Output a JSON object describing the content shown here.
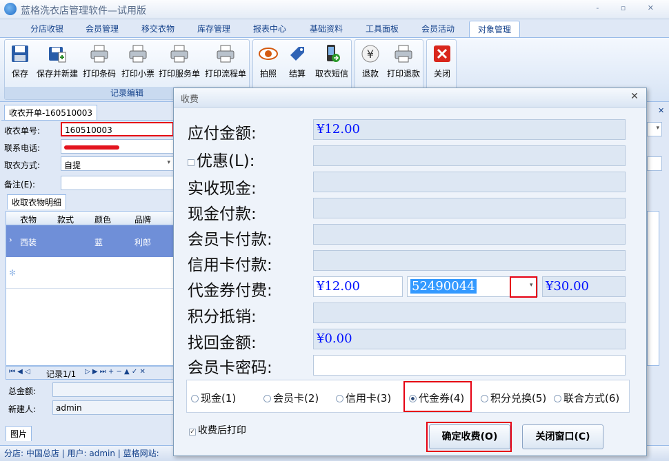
{
  "window": {
    "title": "蓝格洗衣店管理软件—试用版",
    "controls": "- ▫ ✕"
  },
  "tabs": [
    "分店收银",
    "会员管理",
    "移交衣物",
    "库存管理",
    "报表中心",
    "基础资料",
    "工具面板",
    "会员活动",
    "对象管理"
  ],
  "ribbon": {
    "group1": {
      "title": "记录编辑",
      "buttons": [
        "保存",
        "保存并新建",
        "打印条码",
        "打印小票",
        "打印服务单",
        "打印流程单"
      ]
    },
    "group2": {
      "buttons": [
        "拍照",
        "结算",
        "取衣短信"
      ]
    },
    "group3": {
      "buttons": [
        "退款",
        "打印退款"
      ]
    },
    "group4": {
      "buttons": [
        "关闭"
      ]
    }
  },
  "order": {
    "doc_tab": "收衣开单-160510003",
    "order_no_label": "收衣单号:",
    "order_no": "160510003",
    "phone_label": "联系电话:",
    "pickup_label": "取衣方式:",
    "pickup": "自提",
    "remark_label": "备注(E):",
    "detail_tab": "收取衣物明细",
    "columns": [
      "衣物",
      "款式",
      "颜色",
      "品牌"
    ],
    "row": {
      "item": "西装",
      "style": "",
      "color": "蓝",
      "brand": "利郎"
    },
    "pager": "记录1/1",
    "total_label": "总金额:",
    "creator_label": "新建人:",
    "creator": "admin",
    "image_tab": "图片"
  },
  "status": {
    "text": "分店: 中国总店 | 用户: admin | 蓝格网站:"
  },
  "dialog": {
    "title": "收费",
    "labels": {
      "payable": "应付金额:",
      "discount": "优惠(L):",
      "actual_cash": "实收现金:",
      "cash_pay": "现金付款:",
      "member_pay": "会员卡付款:",
      "credit_pay": "信用卡付款:",
      "voucher_pay": "代金券付费:",
      "points": "积分抵销:",
      "change": "找回金额:",
      "member_pwd": "会员卡密码:"
    },
    "values": {
      "payable": "¥12.00",
      "voucher_amount": "¥12.00",
      "voucher_code": "52490044",
      "voucher_balance": "¥30.00",
      "change": "¥0.00"
    },
    "pay_methods": [
      "现金(1)",
      "会员卡(2)",
      "信用卡(3)",
      "代金券(4)",
      "积分兑换(5)",
      "联合方式(6)"
    ],
    "selected_method": "代金券(4)",
    "print_after": "收费后打印",
    "confirm_button": "确定收费(O)",
    "close_button": "关闭窗口(C)"
  }
}
